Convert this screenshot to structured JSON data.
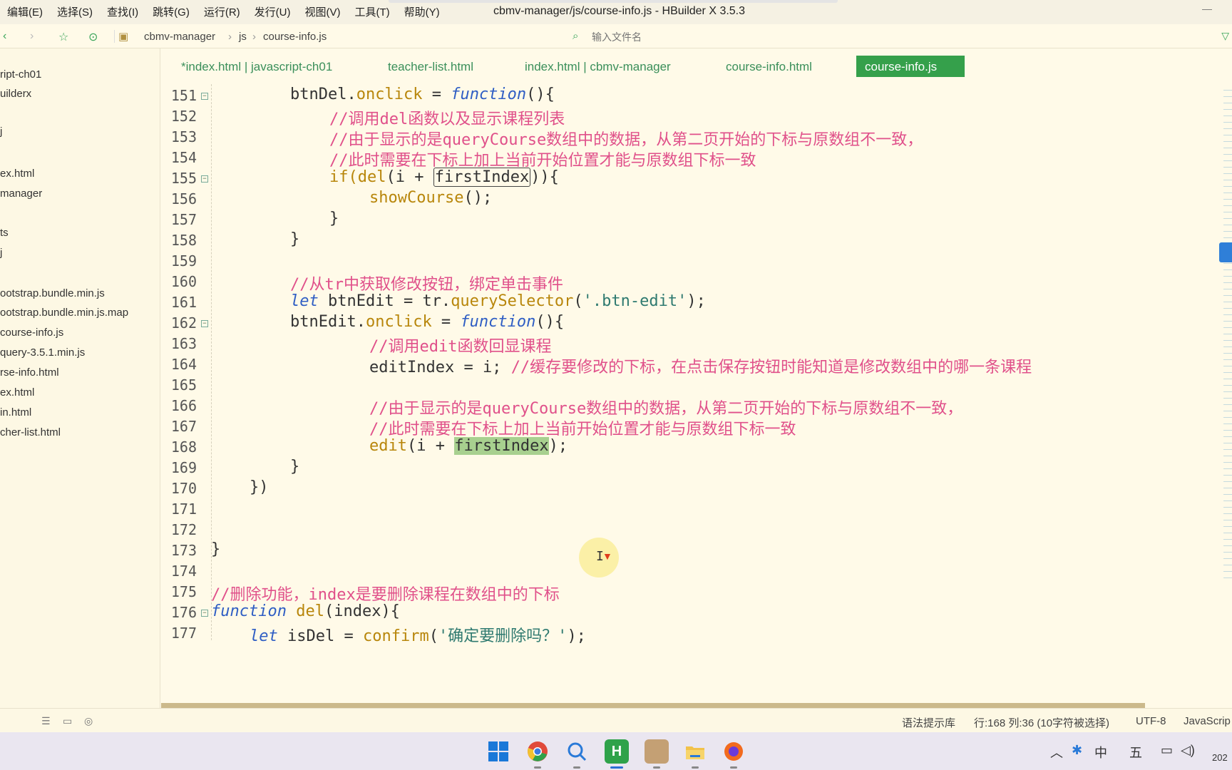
{
  "menu": [
    "编辑(E)",
    "选择(S)",
    "查找(I)",
    "跳转(G)",
    "运行(R)",
    "发行(U)",
    "视图(V)",
    "工具(T)",
    "帮助(Y)"
  ],
  "window_title": "cbmv-manager/js/course-info.js - HBuilder X 3.5.3",
  "breadcrumb": [
    "cbmv-manager",
    "js",
    "course-info.js"
  ],
  "breadcrumb_sep": "›",
  "file_search_placeholder": "输入文件名",
  "sidebar": [
    "ript-ch01",
    "uilderx",
    "j",
    "ex.html",
    "manager",
    "ts",
    "j",
    "ootstrap.bundle.min.js",
    "ootstrap.bundle.min.js.map",
    "course-info.js",
    "query-3.5.1.min.js",
    "rse-info.html",
    "ex.html",
    "in.html",
    "cher-list.html"
  ],
  "tabs": [
    "*index.html | javascript-ch01",
    "teacher-list.html",
    "index.html | cbmv-manager",
    "course-info.html",
    "course-info.js"
  ],
  "active_tab": "course-info.js",
  "lines": [
    {
      "n": "151",
      "fold": true
    },
    {
      "n": "152"
    },
    {
      "n": "153"
    },
    {
      "n": "154"
    },
    {
      "n": "155",
      "fold": true
    },
    {
      "n": "156"
    },
    {
      "n": "157"
    },
    {
      "n": "158"
    },
    {
      "n": "159"
    },
    {
      "n": "160"
    },
    {
      "n": "161"
    },
    {
      "n": "162",
      "fold": true
    },
    {
      "n": "163"
    },
    {
      "n": "164"
    },
    {
      "n": "165"
    },
    {
      "n": "166"
    },
    {
      "n": "167"
    },
    {
      "n": "168"
    },
    {
      "n": "169"
    },
    {
      "n": "170"
    },
    {
      "n": "171"
    },
    {
      "n": "172"
    },
    {
      "n": "173"
    },
    {
      "n": "174"
    },
    {
      "n": "175"
    },
    {
      "n": "176",
      "fold": true
    },
    {
      "n": "177"
    }
  ],
  "code": {
    "l151": {
      "a": "btnDel",
      "b": ".",
      "c": "onclick",
      "d": " = ",
      "e": "function",
      "f": "(){"
    },
    "l152": "//调用del函数以及显示课程列表",
    "l153": "//由于显示的是queryCourse数组中的数据，从第二页开始的下标与原数组不一致，",
    "l154": "//此时需要在下标上加上当前开始位置才能与原数组下标一致",
    "l155": {
      "a": "if(",
      "b": "del",
      "c": "(i + ",
      "d": "firstIndex",
      "e": ")){"
    },
    "l156": {
      "a": "showCourse",
      "b": "();"
    },
    "l157": "}",
    "l158": "}",
    "l160": "//从tr中获取修改按钮，绑定单击事件",
    "l161": {
      "a": "let",
      "b": " btnEdit = tr.",
      "c": "querySelector",
      "d": "(",
      "e": "'.btn-edit'",
      "f": ");"
    },
    "l162": {
      "a": "btnEdit",
      "b": ".",
      "c": "onclick",
      "d": " = ",
      "e": "function",
      "f": "(){"
    },
    "l163": "//调用edit函数回显课程",
    "l164": {
      "a": "editIndex = i; ",
      "b": "//缓存要修改的下标，在点击保存按钮时能知道是修改数组中的哪一条课程"
    },
    "l166": "//由于显示的是queryCourse数组中的数据，从第二页开始的下标与原数组不一致，",
    "l167": "//此时需要在下标上加上当前开始位置才能与原数组下标一致",
    "l168": {
      "a": "edit",
      "b": "(i + ",
      "c": "firstIndex",
      "d": ");"
    },
    "l169": "}",
    "l170": "})",
    "l173": "}",
    "l175": "//删除功能，index是要删除课程在数组中的下标",
    "l176": {
      "a": "function",
      "b": " ",
      "c": "del",
      "d": "(index){"
    },
    "l177": {
      "a": "let",
      "b": " isDel = ",
      "c": "confirm",
      "d": "(",
      "e": "'确定要删除吗？'",
      "f": ");"
    }
  },
  "status": {
    "hint_lib": "语法提示库",
    "position": "行:168  列:36 (10字符被选择)",
    "encoding": "UTF-8",
    "language": "JavaScrip"
  },
  "tray": {
    "ime": "中",
    "day": "五",
    "year": "202"
  },
  "colors": {
    "accent": "#35a04b",
    "comment": "#e0508a",
    "keyword": "#2f5ec4",
    "property": "#b8860b",
    "background": "#fffae8"
  }
}
